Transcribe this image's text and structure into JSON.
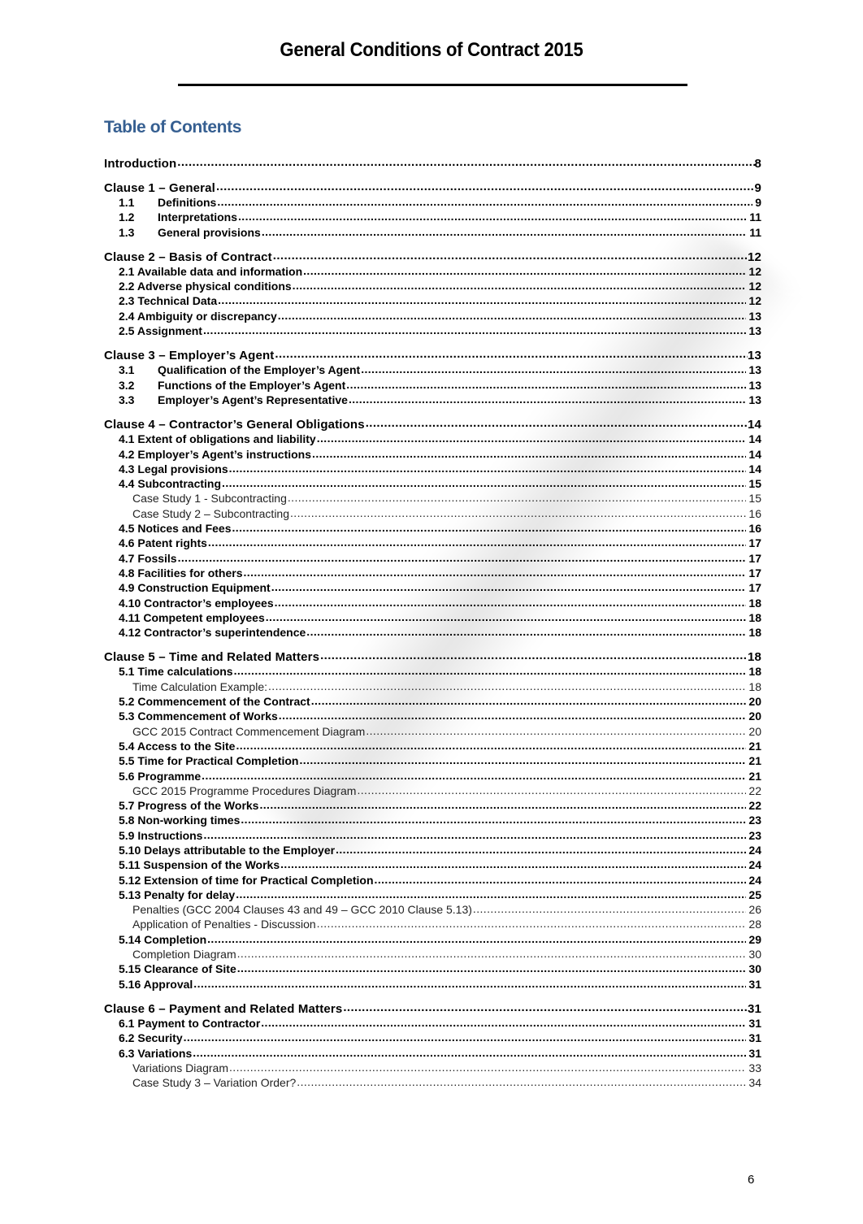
{
  "document": {
    "title": "General Conditions of Contract 2015",
    "toc_heading": "Table of Contents",
    "page_number": "6",
    "heading_color": "#365f91"
  },
  "toc": [
    {
      "level": 0,
      "label": "Introduction",
      "page": "8"
    },
    {
      "level": 0,
      "label": "Clause 1 – General",
      "page": "9"
    },
    {
      "level": 1,
      "num": "1.1",
      "label": "Definitions",
      "page": "9"
    },
    {
      "level": 1,
      "num": "1.2",
      "label": "Interpretations",
      "page": "11"
    },
    {
      "level": 1,
      "num": "1.3",
      "label": "General provisions",
      "page": "11"
    },
    {
      "level": 0,
      "label": "Clause 2 – Basis of Contract",
      "page": "12"
    },
    {
      "level": 1,
      "label": "2.1 Available data and information",
      "page": "12"
    },
    {
      "level": 1,
      "label": "2.2 Adverse physical conditions",
      "page": "12"
    },
    {
      "level": 1,
      "label": "2.3 Technical Data",
      "page": "12"
    },
    {
      "level": 1,
      "label": "2.4 Ambiguity or discrepancy",
      "page": "13"
    },
    {
      "level": 1,
      "label": "2.5 Assignment",
      "page": "13"
    },
    {
      "level": 0,
      "label": "Clause 3 – Employer’s Agent",
      "page": "13"
    },
    {
      "level": 1,
      "num": "3.1",
      "label": "Qualification of the Employer’s Agent",
      "page": "13"
    },
    {
      "level": 1,
      "num": "3.2",
      "label": "Functions of the Employer’s Agent",
      "page": "13"
    },
    {
      "level": 1,
      "num": "3.3",
      "label": "Employer’s Agent’s Representative",
      "page": "13"
    },
    {
      "level": 0,
      "label": "Clause 4 – Contractor’s General Obligations",
      "page": "14"
    },
    {
      "level": 1,
      "label": "4.1 Extent of obligations and liability",
      "page": "14"
    },
    {
      "level": 1,
      "label": "4.2 Employer’s Agent’s instructions",
      "page": "14"
    },
    {
      "level": 1,
      "label": "4.3 Legal provisions",
      "page": "14"
    },
    {
      "level": 1,
      "label": "4.4 Subcontracting",
      "page": "15"
    },
    {
      "level": 2,
      "label": "Case Study 1 - Subcontracting",
      "page": "15"
    },
    {
      "level": 2,
      "label": "Case Study 2 – Subcontracting",
      "page": "16"
    },
    {
      "level": 1,
      "label": "4.5 Notices and Fees",
      "page": "16"
    },
    {
      "level": 1,
      "label": "4.6 Patent rights",
      "page": "17"
    },
    {
      "level": 1,
      "label": "4.7 Fossils",
      "page": "17"
    },
    {
      "level": 1,
      "label": "4.8 Facilities for others",
      "page": "17"
    },
    {
      "level": 1,
      "label": "4.9 Construction Equipment",
      "page": "17"
    },
    {
      "level": 1,
      "label": "4.10 Contractor’s employees",
      "page": "18"
    },
    {
      "level": 1,
      "label": "4.11 Competent employees",
      "page": "18"
    },
    {
      "level": 1,
      "label": "4.12 Contractor’s superintendence",
      "page": "18"
    },
    {
      "level": 0,
      "label": "Clause 5 – Time and Related Matters",
      "page": "18"
    },
    {
      "level": 1,
      "label": "5.1  Time calculations",
      "page": "18"
    },
    {
      "level": 2,
      "label": "Time Calculation Example:",
      "page": "18"
    },
    {
      "level": 1,
      "label": "5.2  Commencement of the Contract",
      "page": "20"
    },
    {
      "level": 1,
      "label": "5.3  Commencement of Works",
      "page": "20"
    },
    {
      "level": 2,
      "label": "GCC 2015 Contract Commencement Diagram",
      "page": "20"
    },
    {
      "level": 1,
      "label": "5.4  Access to the Site",
      "page": "21"
    },
    {
      "level": 1,
      "label": "5.5 Time for Practical Completion",
      "page": "21"
    },
    {
      "level": 1,
      "label": "5.6  Programme",
      "page": "21"
    },
    {
      "level": 2,
      "label": "GCC 2015 Programme Procedures Diagram",
      "page": "22"
    },
    {
      "level": 1,
      "label": "5.7  Progress of the Works",
      "page": "22"
    },
    {
      "level": 1,
      "label": "5.8  Non-working times",
      "page": "23"
    },
    {
      "level": 1,
      "label": "5.9  Instructions",
      "page": "23"
    },
    {
      "level": 1,
      "label": "5.10  Delays attributable to the Employer",
      "page": "24"
    },
    {
      "level": 1,
      "label": "5.11  Suspension of the Works",
      "page": "24"
    },
    {
      "level": 1,
      "label": "5.12  Extension of time for Practical Completion",
      "page": "24"
    },
    {
      "level": 1,
      "label": "5.13  Penalty for delay",
      "page": "25"
    },
    {
      "level": 2,
      "label": "Penalties (GCC 2004 Clauses 43 and 49 – GCC 2010 Clause 5.13)",
      "page": "26"
    },
    {
      "level": 2,
      "label": "Application of Penalties - Discussion",
      "page": "28"
    },
    {
      "level": 1,
      "label": "5.14  Completion",
      "page": "29"
    },
    {
      "level": 2,
      "label": "Completion Diagram",
      "page": "30"
    },
    {
      "level": 1,
      "label": "5.15 Clearance of Site",
      "page": "30"
    },
    {
      "level": 1,
      "label": "5.16  Approval",
      "page": "31"
    },
    {
      "level": 0,
      "label": "Clause 6 – Payment and Related Matters",
      "page": "31"
    },
    {
      "level": 1,
      "label": "6.1  Payment to Contractor",
      "page": "31"
    },
    {
      "level": 1,
      "label": "6.2  Security",
      "page": "31"
    },
    {
      "level": 1,
      "label": "6.3  Variations",
      "page": "31"
    },
    {
      "level": 2,
      "label": "Variations Diagram",
      "page": "33"
    },
    {
      "level": 2,
      "label": "Case Study 3 – Variation Order?",
      "page": "34"
    }
  ]
}
